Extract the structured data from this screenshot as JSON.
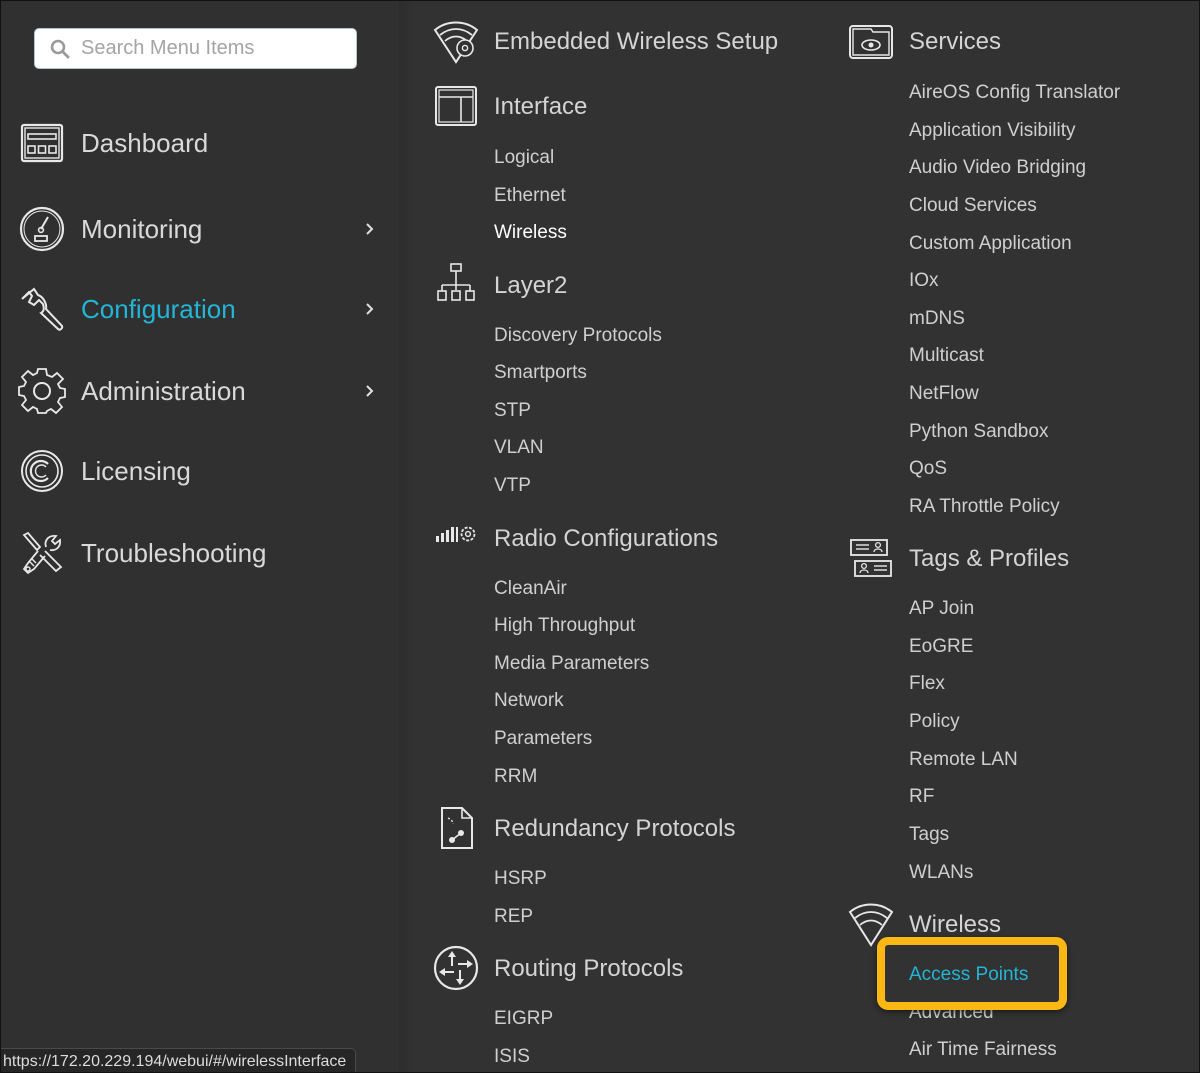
{
  "search": {
    "placeholder": "Search Menu Items"
  },
  "sidebar": {
    "items": [
      {
        "label": "Dashboard",
        "icon": "dashboard-icon",
        "has_submenu": false,
        "active": false
      },
      {
        "label": "Monitoring",
        "icon": "gauge-icon",
        "has_submenu": true,
        "active": false
      },
      {
        "label": "Configuration",
        "icon": "wrench-icon",
        "has_submenu": true,
        "active": true
      },
      {
        "label": "Administration",
        "icon": "gear-icon",
        "has_submenu": true,
        "active": false
      },
      {
        "label": "Licensing",
        "icon": "copyright-icon",
        "has_submenu": false,
        "active": false
      },
      {
        "label": "Troubleshooting",
        "icon": "tools-icon",
        "has_submenu": false,
        "active": false
      }
    ]
  },
  "menu": {
    "embedded_wireless_setup": {
      "title": "Embedded Wireless Setup",
      "icon": "wifi-gear-icon"
    },
    "interface": {
      "title": "Interface",
      "icon": "layout-icon",
      "items": [
        "Logical",
        "Ethernet",
        "Wireless"
      ]
    },
    "layer2": {
      "title": "Layer2",
      "icon": "network-tree-icon",
      "items": [
        "Discovery Protocols",
        "Smartports",
        "STP",
        "VLAN",
        "VTP"
      ]
    },
    "radio_configurations": {
      "title": "Radio Configurations",
      "icon": "signal-gear-icon",
      "items": [
        "CleanAir",
        "High Throughput",
        "Media Parameters",
        "Network",
        "Parameters",
        "RRM"
      ]
    },
    "redundancy_protocols": {
      "title": "Redundancy Protocols",
      "icon": "document-nodes-icon",
      "items": [
        "HSRP",
        "REP"
      ]
    },
    "routing_protocols": {
      "title": "Routing Protocols",
      "icon": "router-arrows-icon",
      "items": [
        "EIGRP",
        "ISIS"
      ]
    },
    "services": {
      "title": "Services",
      "icon": "folder-eye-icon",
      "items": [
        "AireOS Config Translator",
        "Application Visibility",
        "Audio Video Bridging",
        "Cloud Services",
        "Custom Application",
        "IOx",
        "mDNS",
        "Multicast",
        "NetFlow",
        "Python Sandbox",
        "QoS",
        "RA Throttle Policy"
      ]
    },
    "tags_profiles": {
      "title": "Tags & Profiles",
      "icon": "id-cards-icon",
      "items": [
        "AP Join",
        "EoGRE",
        "Flex",
        "Policy",
        "Remote LAN",
        "RF",
        "Tags",
        "WLANs"
      ]
    },
    "wireless": {
      "title": "Wireless",
      "icon": "wifi-icon",
      "items": [
        "Access Points",
        "Advanced",
        "Air Time Fairness"
      ]
    }
  },
  "hover_item": "Wireless",
  "highlighted_item": "Access Points",
  "status_bar": {
    "url": "https://172.20.229.194/webui/#/wirelessInterface"
  },
  "colors": {
    "accent": "#23b5d6",
    "highlight_box": "#fbb814",
    "background": "#323232"
  }
}
